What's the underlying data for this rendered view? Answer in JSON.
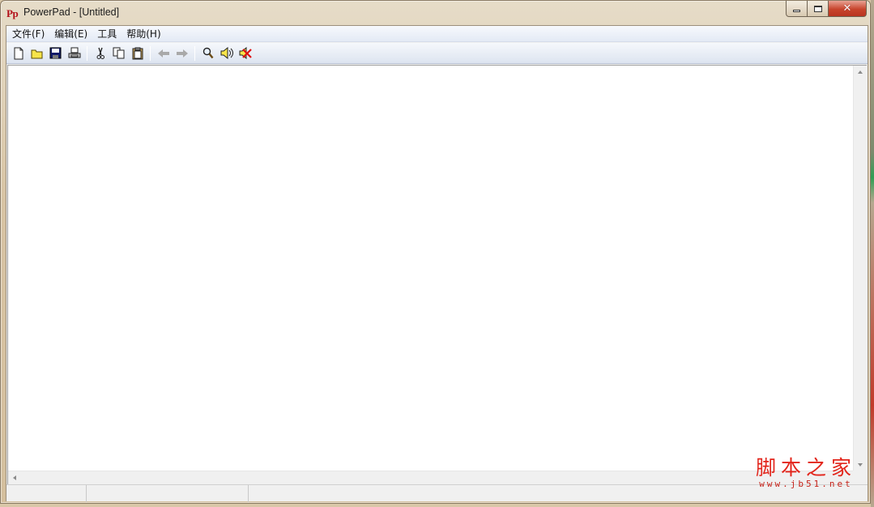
{
  "window": {
    "app_icon_text": "Pp",
    "title": "PowerPad - [Untitled]",
    "controls": {
      "minimize": "",
      "maximize": "",
      "close": "✕"
    }
  },
  "menu": {
    "items": [
      {
        "label": "文件(F)"
      },
      {
        "label": "编辑(E)"
      },
      {
        "label": "工具"
      },
      {
        "label": "帮助(H)"
      }
    ]
  },
  "toolbar": {
    "buttons": [
      {
        "icon": "new-file-icon"
      },
      {
        "icon": "open-folder-icon"
      },
      {
        "icon": "save-icon"
      },
      {
        "icon": "print-icon"
      },
      {
        "icon": "cut-icon"
      },
      {
        "icon": "copy-icon"
      },
      {
        "icon": "paste-icon"
      },
      {
        "icon": "undo-arrow-icon",
        "enabled": false
      },
      {
        "icon": "redo-arrow-icon",
        "enabled": false
      },
      {
        "icon": "find-icon"
      },
      {
        "icon": "speak-icon"
      },
      {
        "icon": "stop-speak-icon"
      }
    ]
  },
  "editor": {
    "content": ""
  },
  "statusbar": {
    "panes": [
      "",
      "",
      ""
    ]
  },
  "watermark": {
    "logo": "脚本之家",
    "url": "www.jb51.net"
  },
  "colors": {
    "accent_red": "#e2241a",
    "title_icon_red": "#b3121b"
  }
}
